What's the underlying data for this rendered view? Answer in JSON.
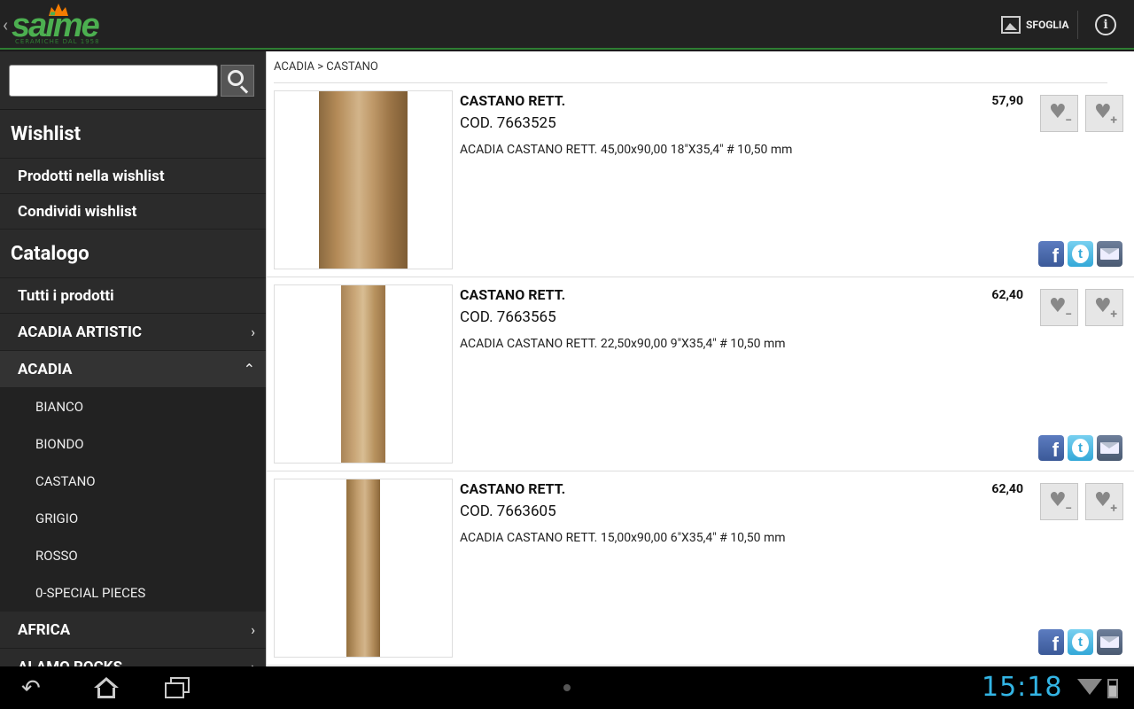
{
  "app": {
    "logo_text": "saime",
    "logo_tagline": "CERAMICHE DAL 1958",
    "back_chevron": "‹",
    "browse_label": "SFOGLIA",
    "info_glyph": "i"
  },
  "sidebar": {
    "search": {
      "value": "",
      "placeholder": ""
    },
    "wishlist_header": "Wishlist",
    "wishlist_items": [
      {
        "label": "Prodotti nella wishlist"
      },
      {
        "label": "Condividi wishlist"
      }
    ],
    "catalog_header": "Catalogo",
    "all_products": "Tutti i prodotti",
    "categories": [
      {
        "label": "ACADIA ARTISTIC",
        "chevron": "›"
      },
      {
        "label": "ACADIA",
        "chevron": "⌃"
      },
      {
        "label": "AFRICA",
        "chevron": "›"
      },
      {
        "label": "ALAMO ROCKS",
        "chevron": "›"
      }
    ],
    "acadia_subitems": [
      {
        "label": "BIANCO"
      },
      {
        "label": "BIONDO"
      },
      {
        "label": "CASTANO"
      },
      {
        "label": "GRIGIO"
      },
      {
        "label": "ROSSO"
      },
      {
        "label": "0-SPECIAL PIECES"
      }
    ]
  },
  "main": {
    "breadcrumb": "ACADIA > CASTANO",
    "products": [
      {
        "title": "CASTANO RETT.",
        "code": "COD. 7663525",
        "description": "ACADIA CASTANO RETT. 45,00x90,00 18\"X35,4\" # 10,50 mm",
        "price": "57,90"
      },
      {
        "title": "CASTANO RETT.",
        "code": "COD. 7663565",
        "description": "ACADIA CASTANO RETT. 22,50x90,00 9\"X35,4\" # 10,50 mm",
        "price": "62,40"
      },
      {
        "title": "CASTANO RETT.",
        "code": "COD. 7663605",
        "description": "ACADIA CASTANO RETT. 15,00x90,00 6\"X35,4\" # 10,50 mm",
        "price": "62,40"
      }
    ],
    "wish_minus_sign": "−",
    "wish_plus_sign": "+",
    "heart_glyph": "♥",
    "facebook_glyph": "f",
    "twitter_glyph": "t"
  },
  "system_bar": {
    "clock": "15:18",
    "back_glyph": "↶"
  },
  "colors": {
    "accent_green": "#2e7d32",
    "clock_blue": "#33b5e5",
    "facebook": "#3b5998",
    "twitter": "#33a8d8"
  }
}
